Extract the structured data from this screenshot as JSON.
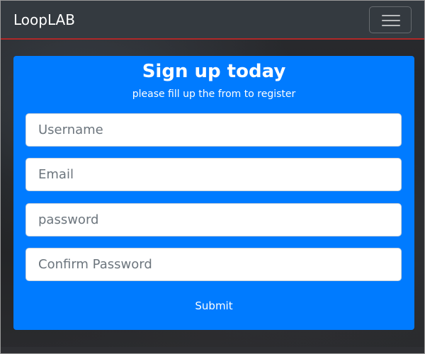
{
  "navbar": {
    "brand": "LoopLAB",
    "toggler_icon": "hamburger-menu-icon"
  },
  "form": {
    "title": "Sign up today",
    "subtitle": "please fill up the from to register",
    "fields": [
      {
        "placeholder": "Username",
        "value": "",
        "type": "text"
      },
      {
        "placeholder": "Email",
        "value": "",
        "type": "email"
      },
      {
        "placeholder": "password",
        "value": "",
        "type": "password"
      },
      {
        "placeholder": "Confirm Password",
        "value": "",
        "type": "password"
      }
    ],
    "submit_label": "Submit"
  },
  "colors": {
    "navbar": "#343a40",
    "navbar_border": "#b02828",
    "card": "#007bff",
    "text_light": "#ffffff"
  }
}
